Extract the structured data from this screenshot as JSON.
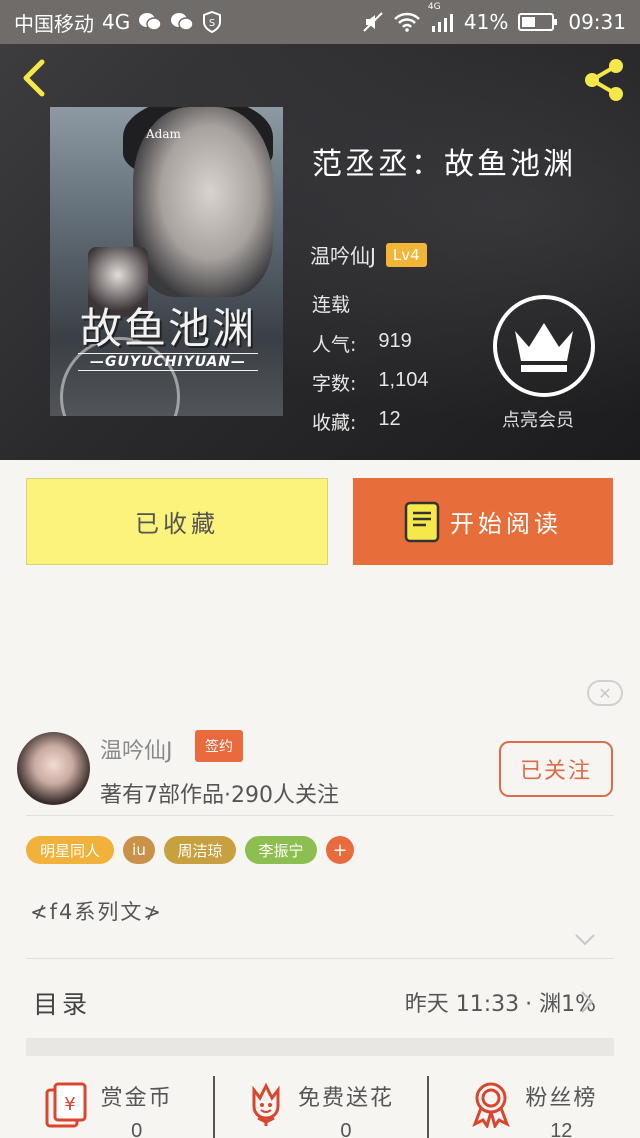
{
  "status_bar": {
    "carrier": "中国移动",
    "network": "4G",
    "signal_type": "4G",
    "battery": "41%",
    "time": "09:31"
  },
  "book": {
    "title": "范丞丞：故鱼池渊",
    "author": "温吟仙J",
    "level": "Lv4",
    "status": "连载",
    "popularity_label": "人气:",
    "popularity": "919",
    "words_label": "字数:",
    "words": "1,104",
    "favorites_label": "收藏:",
    "favorites": "12",
    "vip_label": "点亮会员"
  },
  "cover": {
    "title": "故鱼池渊",
    "pinyin": "—GUYUCHIYUAN—",
    "top_text": "Adam"
  },
  "actions": {
    "favorited_label": "已收藏",
    "read_label": "开始阅读"
  },
  "author_section": {
    "name": "温吟仙J",
    "sign_badge": "签约",
    "works_text": "著有7部作品·290人关注",
    "follow_label": "已关注"
  },
  "tags": [
    {
      "label": "明星同人",
      "color": "#f0b23a"
    },
    {
      "label": "iu",
      "color": "#c9914a"
    },
    {
      "label": "周洁琼",
      "color": "#c9a03f"
    },
    {
      "label": "李振宁",
      "color": "#8cbf4f"
    }
  ],
  "series": "≮f4系列文≯",
  "toc": {
    "label": "目录",
    "update_time": "昨天 11:33",
    "latest": "· 渊1%"
  },
  "bottom_bar": [
    {
      "label": "赏金币",
      "count": "0",
      "icon": "red-envelope-icon"
    },
    {
      "label": "免费送花",
      "count": "0",
      "icon": "flower-icon"
    },
    {
      "label": "粉丝榜",
      "count": "12",
      "icon": "medal-icon"
    }
  ],
  "colors": {
    "accent_orange": "#e76d3a",
    "fav_yellow": "#fbf37c",
    "icon_yellow": "#f6e84a",
    "bottom_icon_red": "#d9452f"
  }
}
